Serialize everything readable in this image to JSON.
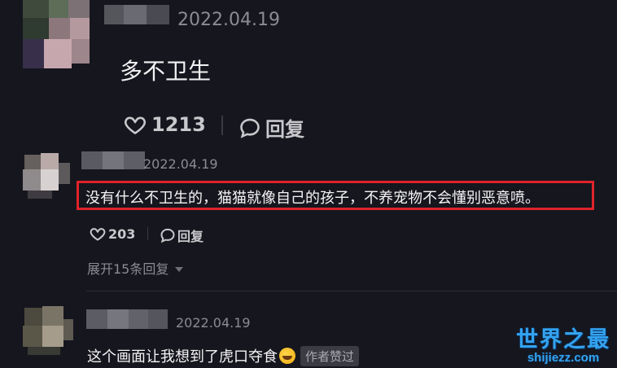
{
  "comments": [
    {
      "date": "2022.04.19",
      "text": "多不卫生",
      "likes": "1213",
      "reply_label": "回复"
    },
    {
      "date": "2022.04.19",
      "text": "没有什么不卫生的，猫猫就像自己的孩子，不养宠物不会懂别恶意喷。",
      "likes": "203",
      "reply_label": "回复",
      "expand_label": "展开15条回复"
    },
    {
      "date": "2022.04.19",
      "text": "这个画面让我想到了虎口夺食",
      "badge": "作者赞过"
    }
  ],
  "watermark": {
    "title": "世界之最",
    "url": "shijiezz.com"
  },
  "colors": {
    "background": "#16161e",
    "highlight_border": "#e0232a",
    "watermark": "#34a3f0"
  },
  "icons": [
    "heart-icon",
    "comment-bubble-icon",
    "chevron-down-icon",
    "laughing-emoji-icon"
  ]
}
